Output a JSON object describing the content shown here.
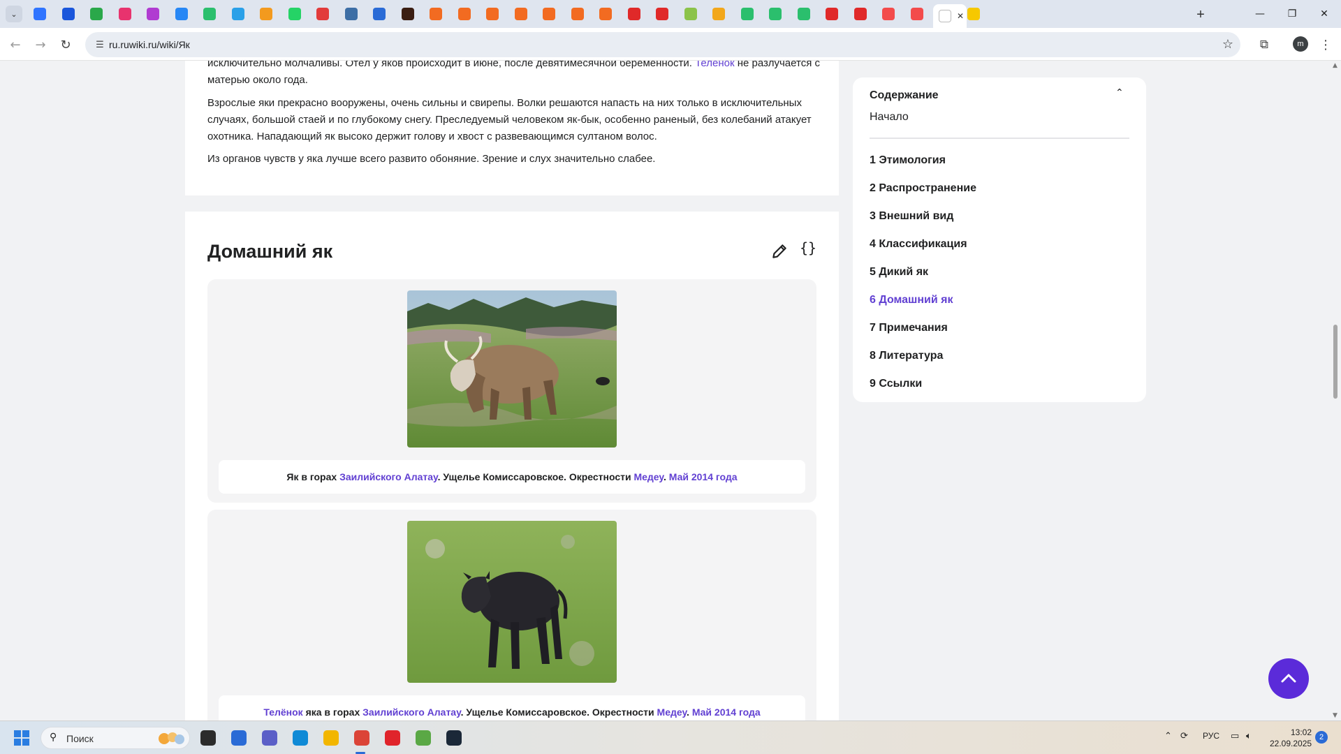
{
  "browser": {
    "tabs": [
      {
        "icon": "yandex-icon",
        "color": "#2f74ff"
      },
      {
        "icon": "m-icon",
        "color": "#1a56db"
      },
      {
        "icon": "pinwheel-icon",
        "color": "#2aa84a"
      },
      {
        "icon": "messenger-icon",
        "color": "#e8336e"
      },
      {
        "icon": "wb-icon",
        "color": "#b03bd1"
      },
      {
        "icon": "vk-icon",
        "color": "#2787f5"
      },
      {
        "icon": "dots-icon",
        "color": "#2bbf6d"
      },
      {
        "icon": "telegram-icon",
        "color": "#2aa0e8"
      },
      {
        "icon": "ok-icon",
        "color": "#f39a1e"
      },
      {
        "icon": "whatsapp-icon",
        "color": "#25d366"
      },
      {
        "icon": "video-icon",
        "color": "#e23b3b"
      },
      {
        "icon": "mascot-icon",
        "color": "#3d6ea5"
      },
      {
        "icon": "chat-icon",
        "color": "#2a6bd6"
      },
      {
        "icon": "dark-icon",
        "color": "#3b1e12"
      },
      {
        "icon": "orange-icon",
        "color": "#f26b21"
      },
      {
        "icon": "orange-icon",
        "color": "#f26b21"
      },
      {
        "icon": "orange-icon",
        "color": "#f26b21"
      },
      {
        "icon": "orange-icon",
        "color": "#f26b21"
      },
      {
        "icon": "orange-icon",
        "color": "#f26b21"
      },
      {
        "icon": "orange-icon",
        "color": "#f26b21"
      },
      {
        "icon": "orange-icon",
        "color": "#f26b21"
      },
      {
        "icon": "cross-icon",
        "color": "#e02929"
      },
      {
        "icon": "red-play-icon",
        "color": "#e02929"
      },
      {
        "icon": "green-icon",
        "color": "#8bc34a"
      },
      {
        "icon": "mail-icon",
        "color": "#f2a71b"
      },
      {
        "icon": "dots-icon",
        "color": "#2bbf6d"
      },
      {
        "icon": "dots-icon",
        "color": "#2bbf6d"
      },
      {
        "icon": "dots-icon",
        "color": "#2bbf6d"
      },
      {
        "icon": "red-play-icon",
        "color": "#e02929"
      },
      {
        "icon": "red-play-icon",
        "color": "#e02929"
      },
      {
        "icon": "yandex-y-icon",
        "color": "#f34b4b"
      },
      {
        "icon": "yandex-y-icon",
        "color": "#f34b4b"
      },
      {
        "icon": "ruwiki-icon",
        "color": "#ffffff",
        "active": true
      },
      {
        "icon": "yellow-icon",
        "color": "#f6c800"
      }
    ],
    "url": "ru.ruwiki.ru/wiki/Як",
    "profile_initial": "m"
  },
  "article": {
    "para1": {
      "text_a": "исключительно молчаливы. Отёл у яков происходит в июне, после девятимесячной беременности. ",
      "link": "Телёнок",
      "text_b": " не разлучается с матерью около года."
    },
    "para2": "Взрослые яки прекрасно вооружены, очень сильны и свирепы. Волки решаются напасть на них только в исключительных случаях, большой стаей и по глубокому снегу. Преследуемый человеком як-бык, особенно раненый, без колебаний атакует охотника. Нападающий як высоко держит голову и хвост с развевающимся султаном волос.",
    "para3": "Из органов чувств у яка лучше всего развито обоняние. Зрение и слух значительно слабее.",
    "section_title": "Домашний як",
    "figure1": {
      "t1": "Як в горах ",
      "l1": "Заилийского Алатау",
      "t2": ". Ущелье Комиссаровское. Окрестности ",
      "l2": "Медеу",
      "t3": ". ",
      "l3": "Май 2014 года"
    },
    "figure2": {
      "l0": "Телёнок",
      "t1": " яка в горах ",
      "l1": "Заилийского Алатау",
      "t2": ". Ущелье Комиссаровское. Окрестности ",
      "l2": "Медеу",
      "t3": ". ",
      "l3": "Май 2014 года"
    }
  },
  "toc": {
    "title": "Содержание",
    "start": "Начало",
    "items": [
      "1 Этимология",
      "2 Распространение",
      "3 Внешний вид",
      "4 Классификация",
      "5 Дикий як",
      "6 Домашний як",
      "7 Примечания",
      "8 Литература",
      "9 Ссылки"
    ],
    "active_index": 5
  },
  "taskbar": {
    "search_label": "Поиск",
    "language": "РУС",
    "time": "13:02",
    "date": "22.09.2025",
    "notifications": "2",
    "apps": [
      "app-icon",
      "widgets-icon",
      "teams-icon",
      "edge-icon",
      "file-explorer-icon",
      "chrome-icon",
      "opera-icon",
      "utorrent-icon",
      "steam-icon"
    ]
  },
  "colors": {
    "accent": "#6140d2",
    "scroll_top_button": "#5b2bd9"
  }
}
